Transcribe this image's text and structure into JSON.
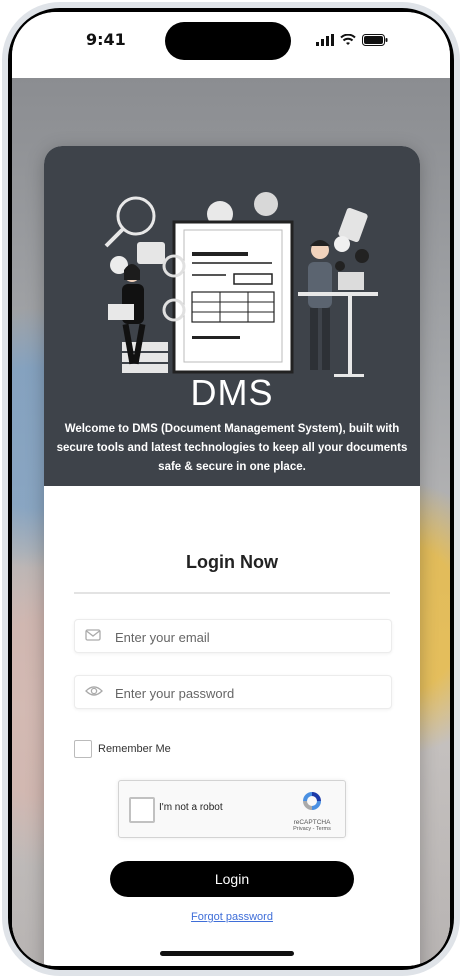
{
  "status_bar": {
    "time": "9:41"
  },
  "hero": {
    "title": "DMS",
    "description": "Welcome to DMS (Document Management System), built with secure tools and latest technologies to keep all your documents safe & secure in one place."
  },
  "login": {
    "title": "Login Now",
    "email_placeholder": "Enter your email",
    "password_placeholder": "Enter your password",
    "remember_label": "Remember Me",
    "captcha_label": "I'm not a robot",
    "captcha_brand": "reCAPTCHA",
    "captcha_links": "Privacy - Terms",
    "button_label": "Login",
    "forgot_label": "Forgot password"
  },
  "colors": {
    "hero_bg": "#3e434a",
    "button_bg": "#000000",
    "link": "#3f6ed8"
  }
}
